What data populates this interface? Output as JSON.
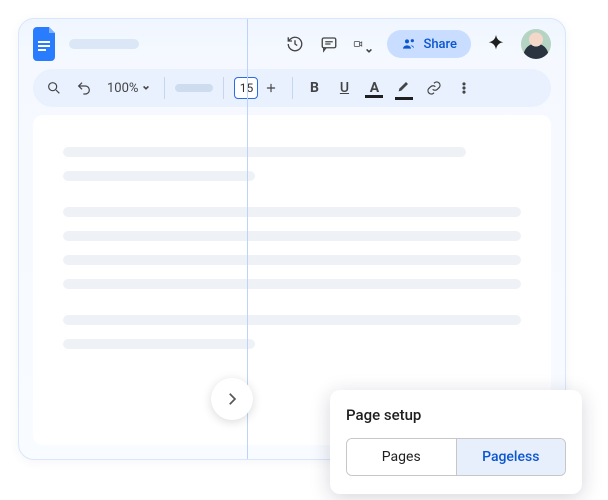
{
  "topbar": {
    "share_label": "Share"
  },
  "toolbar": {
    "zoom": "100%",
    "font_size": "15",
    "bold": "B",
    "underline": "U",
    "color_a": "A"
  },
  "popup": {
    "title": "Page setup",
    "option_pages": "Pages",
    "option_pageless": "Pageless"
  }
}
